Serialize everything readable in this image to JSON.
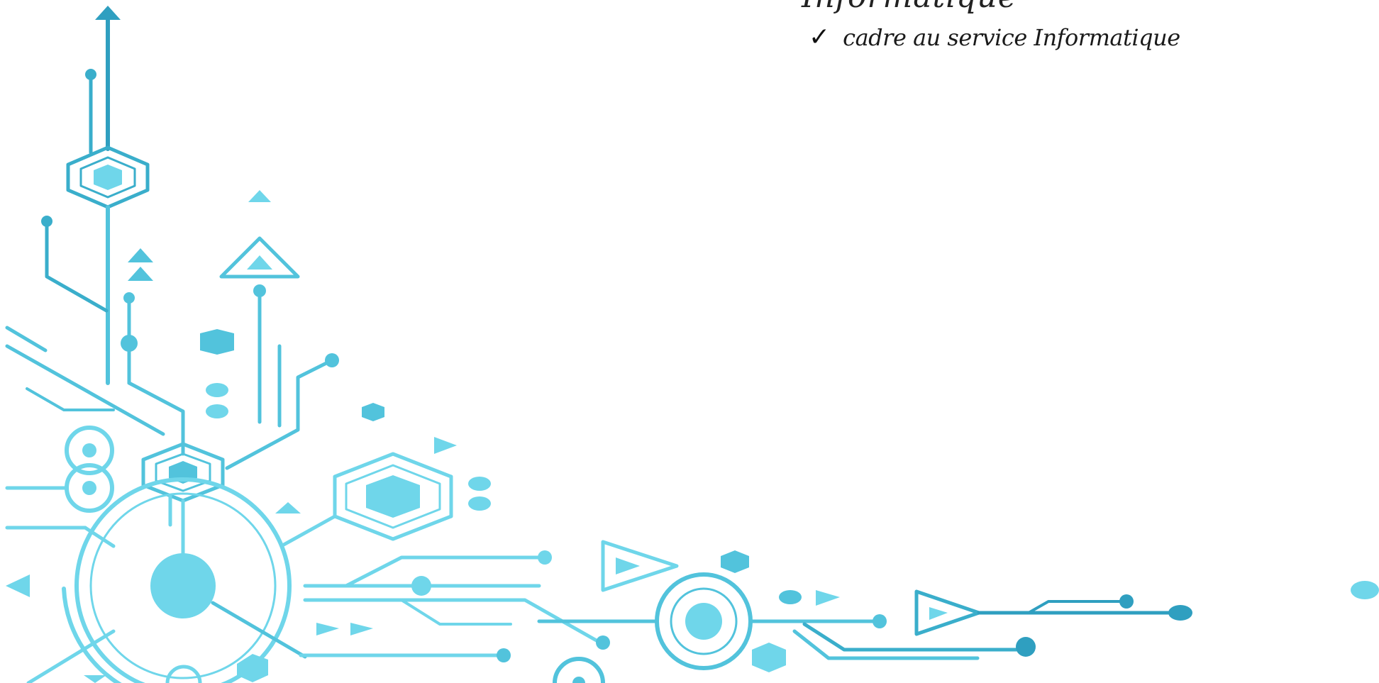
{
  "document": {
    "heading_partial": "Informatique",
    "bullet_items": [
      {
        "icon": "checkmark-icon",
        "glyph": "✓",
        "text": "cadre au service Informatique"
      }
    ]
  },
  "decoration": {
    "name": "circuit-board-corner-ornament",
    "colors": {
      "light": "#6fd6ea",
      "mid": "#52c3dc",
      "dark": "#2f9fc0"
    }
  }
}
